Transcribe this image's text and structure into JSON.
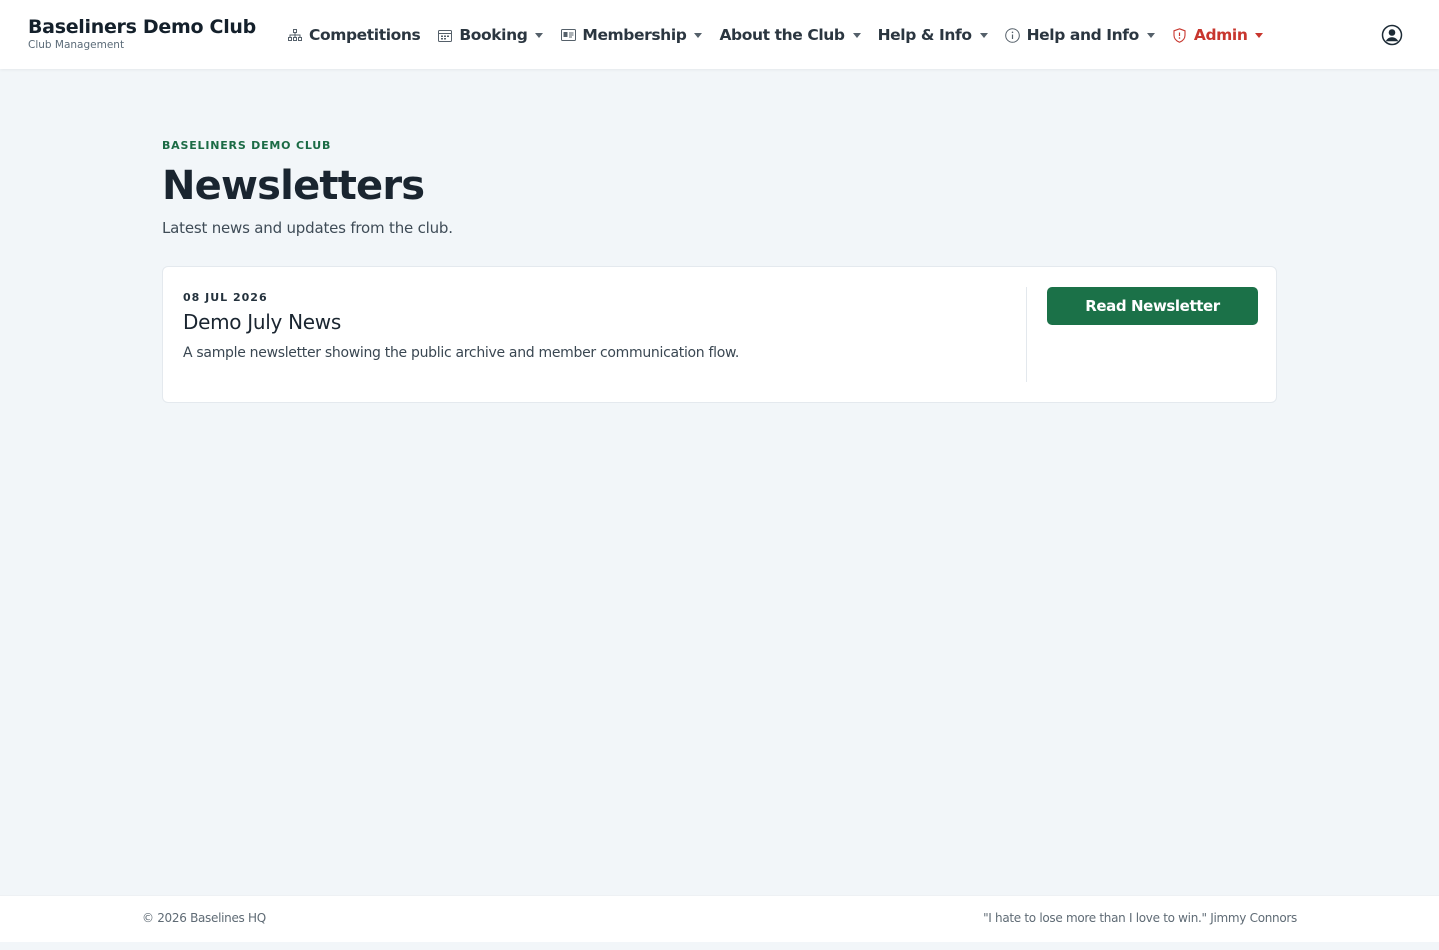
{
  "brand": {
    "name": "Baseliners Demo Club",
    "subtitle": "Club Management"
  },
  "nav": {
    "competitions": "Competitions",
    "booking": "Booking",
    "membership": "Membership",
    "about": "About the Club",
    "help_amp": "Help & Info",
    "help_and": "Help and Info",
    "admin": "Admin"
  },
  "icons": {
    "competitions": "sitemap-icon",
    "booking": "calendar-icon",
    "membership": "id-card-icon",
    "help": "info-circle-icon",
    "admin": "shield-icon",
    "user": "user-circle-icon"
  },
  "colors": {
    "accent": "#1b7148",
    "admin": "#c8362e",
    "background": "#f2f6f9"
  },
  "page": {
    "eyebrow": "BASELINERS DEMO CLUB",
    "title": "Newsletters",
    "subtitle": "Latest news and updates from the club."
  },
  "newsletters": [
    {
      "date": "08 JUL 2026",
      "title": "Demo July News",
      "description": "A sample newsletter showing the public archive and member communication flow.",
      "button": "Read Newsletter"
    }
  ],
  "footer": {
    "copyright": "© 2026 Baselines HQ",
    "quote": "\"I hate to lose more than I love to win.\" Jimmy Connors"
  }
}
